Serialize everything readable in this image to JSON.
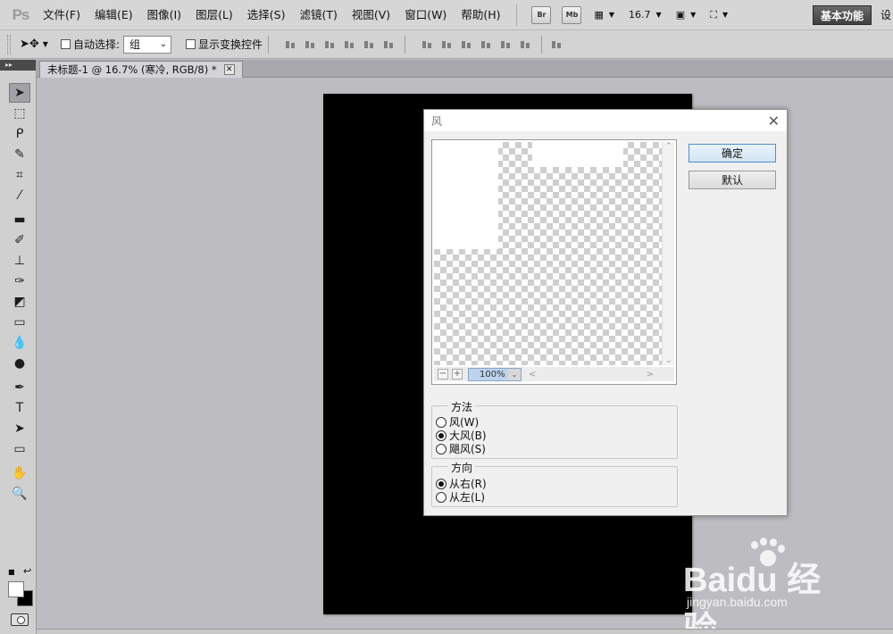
{
  "app": {
    "logo": "Ps",
    "menu": [
      "文件(F)",
      "编辑(E)",
      "图像(I)",
      "图层(L)",
      "选择(S)",
      "滤镜(T)",
      "视图(V)",
      "窗口(W)",
      "帮助(H)"
    ],
    "bridge_label": "Br",
    "minibridge_label": "Mb",
    "zoom_level": "16.7",
    "workspace": "基本功能",
    "clip_glyph": "设"
  },
  "options_bar": {
    "auto_select_label": "自动选择:",
    "auto_select_value": "组",
    "show_transform_label": "显示变换控件"
  },
  "document": {
    "tab_title": "未标题-1 @ 16.7% (寒冷, RGB/8) *",
    "canvas_color": "#000000"
  },
  "dialog": {
    "title": "风",
    "ok_label": "确定",
    "default_label": "默认",
    "preview_zoom": "100%",
    "method_group_label": "方法",
    "method_options": [
      {
        "label": "风(W)",
        "selected": false
      },
      {
        "label": "大风(B)",
        "selected": true
      },
      {
        "label": "飓风(S)",
        "selected": false
      }
    ],
    "direction_group_label": "方向",
    "direction_options": [
      {
        "label": "从右(R)",
        "selected": true
      },
      {
        "label": "从左(L)",
        "selected": false
      }
    ]
  },
  "watermark": {
    "brand": "Baidu 经验",
    "url": "jingyan.baidu.com"
  },
  "icons": {
    "move_tool": "move-icon",
    "marquee_tool": "marquee-icon",
    "lasso_tool": "lasso-icon",
    "quick_select_tool": "quick-select-icon",
    "crop_tool": "crop-icon",
    "eyedropper_tool": "eyedropper-icon",
    "heal_tool": "healing-brush-icon",
    "brush_tool": "brush-icon",
    "stamp_tool": "clone-stamp-icon",
    "history_brush_tool": "history-brush-icon",
    "eraser_tool": "eraser-icon",
    "gradient_tool": "gradient-icon",
    "blur_tool": "blur-icon",
    "dodge_tool": "dodge-icon",
    "pen_tool": "pen-icon",
    "type_tool": "type-icon",
    "path_select_tool": "path-selection-icon",
    "shape_tool": "rectangle-shape-icon",
    "hand_tool": "hand-icon",
    "zoom_tool": "zoom-icon"
  }
}
